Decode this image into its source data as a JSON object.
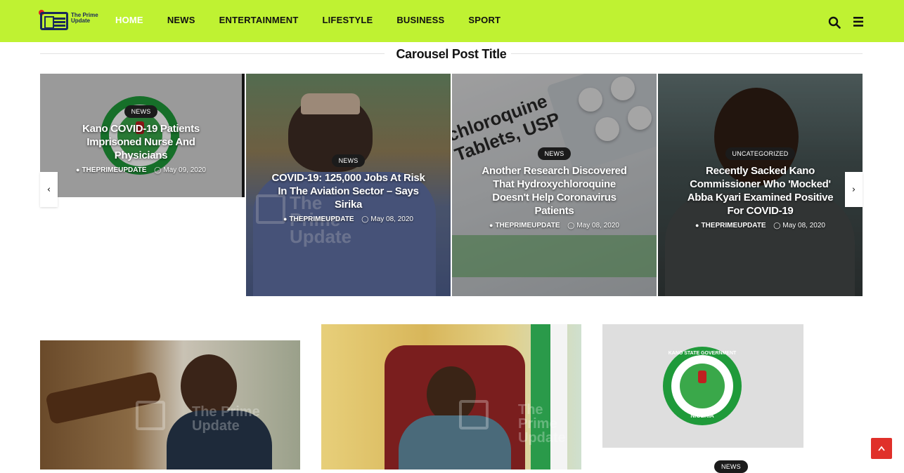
{
  "logo": {
    "text": "The Prime Update"
  },
  "nav": {
    "items": [
      {
        "label": "HOME"
      },
      {
        "label": "NEWS"
      },
      {
        "label": "ENTERTAINMENT"
      },
      {
        "label": "LIFESTYLE"
      },
      {
        "label": "BUSINESS"
      },
      {
        "label": "SPORT"
      }
    ]
  },
  "section": {
    "title": "Carousel Post Title"
  },
  "carousel": {
    "slides": [
      {
        "category": "NEWS",
        "title": "Kano COVID-19 Patients Imprisoned Nurse And Physicians",
        "author": "THEPRIMEUPDATE",
        "date": "May 09, 2020"
      },
      {
        "category": "NEWS",
        "title": "COVID-19: 125,000 Jobs At Risk In The Aviation Sector – Says Sirika",
        "author": "THEPRIMEUPDATE",
        "date": "May 08, 2020"
      },
      {
        "category": "NEWS",
        "title": "Another Research Discovered That Hydroxychloroquine Doesn't Help Coronavirus Patients",
        "author": "THEPRIMEUPDATE",
        "date": "May 08, 2020"
      },
      {
        "category": "UNCATEGORIZED",
        "title": "Recently Sacked Kano Commissioner Who 'Mocked' Abba Kyari Examined Positive For COVID-19",
        "author": "THEPRIMEUPDATE",
        "date": "May 08, 2020"
      }
    ],
    "prev_symbol": "‹",
    "next_symbol": "›"
  },
  "images": {
    "watermark": "The Prime Update",
    "pill_text": "chloroquine Tablets, USP",
    "seal_top": "KANO STATE GOVERNMENT",
    "seal_bottom": "NIGERIA"
  },
  "bottom": {
    "badge": "NEWS"
  },
  "colors": {
    "header_bg": "#bff232",
    "accent_red": "#e0302a",
    "seal_green": "#1f9a3a"
  }
}
